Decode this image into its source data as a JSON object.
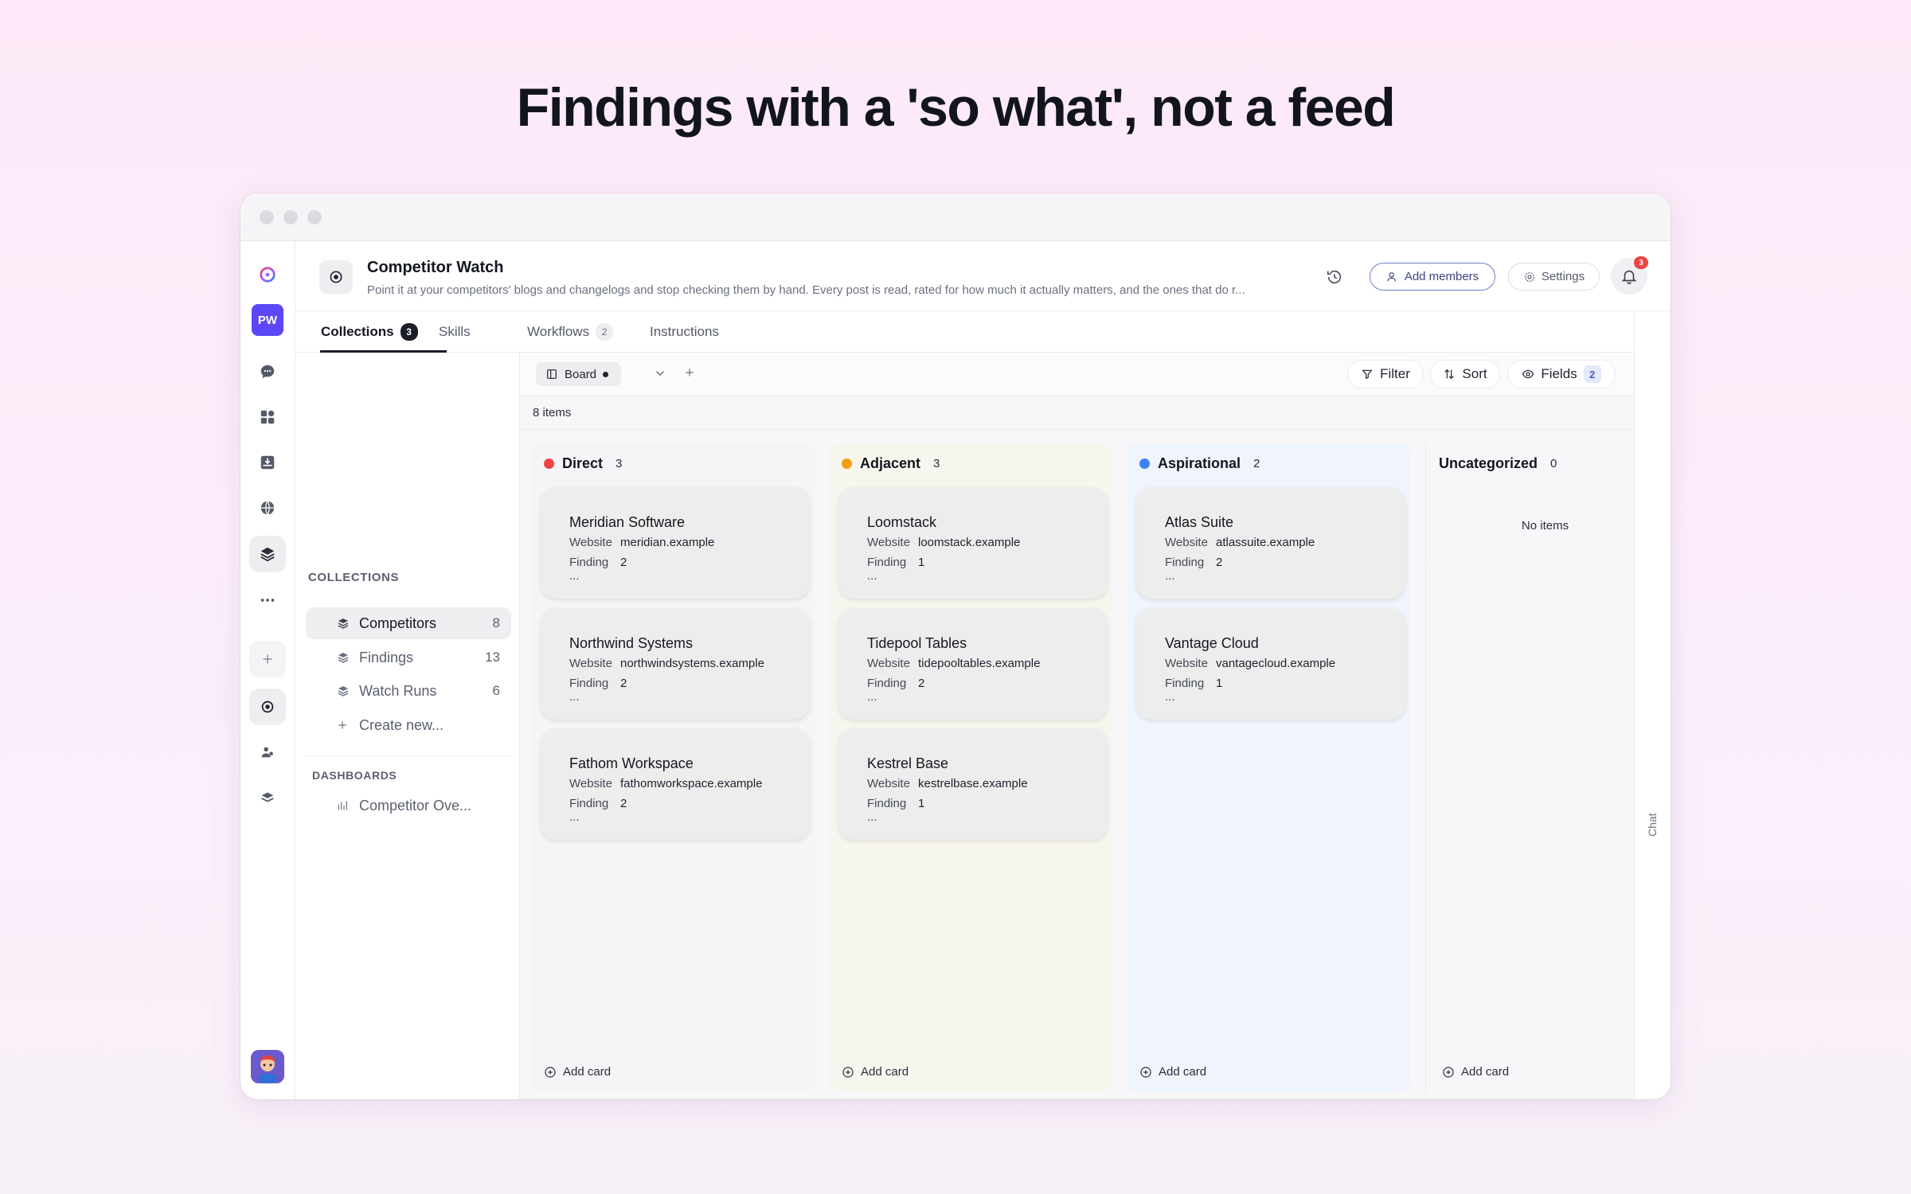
{
  "headline": "Findings with a 'so what', not a feed",
  "rail": {
    "workspace_initials": "PW",
    "icons": [
      "app-logo-icon",
      "chat-icon",
      "apps-grid-icon",
      "inbox-icon",
      "globe-icon",
      "layers-icon",
      "more-icon",
      "plus-icon",
      "project-icon",
      "people-icon",
      "stack-icon",
      "user-avatar"
    ]
  },
  "header": {
    "title": "Competitor Watch",
    "description": "Point it at your competitors' blogs and changelogs and stop checking them by hand. Every post is read, rated for how much it actually matters, and the ones that do r...",
    "add_members_label": "Add members",
    "settings_label": "Settings",
    "notification_count": "3"
  },
  "tabs": [
    {
      "label": "Collections",
      "count": "3"
    },
    {
      "label": "Skills",
      "count": ""
    },
    {
      "label": "Workflows",
      "count": "2"
    },
    {
      "label": "Instructions",
      "count": ""
    }
  ],
  "sidebar": {
    "collections_label": "COLLECTIONS",
    "items": [
      {
        "label": "Competitors",
        "count": "8"
      },
      {
        "label": "Findings",
        "count": "13"
      },
      {
        "label": "Watch Runs",
        "count": "6"
      }
    ],
    "create_label": "Create new...",
    "dashboards_label": "DASHBOARDS",
    "dashboards": [
      {
        "label": "Competitor Ove..."
      }
    ]
  },
  "toolbar": {
    "view_label": "Board",
    "filter_label": "Filter",
    "sort_label": "Sort",
    "fields_label": "Fields",
    "fields_count": "2",
    "items_count": "8 items"
  },
  "colors": {
    "direct": "#ef4444",
    "adjacent": "#f59e0b",
    "aspirational": "#3b82f6",
    "accent": "#5b47f5"
  },
  "columns": [
    {
      "name": "Direct",
      "count": "3",
      "cards": [
        {
          "title": "Meridian Software",
          "website_key": "Website",
          "website": "meridian.example",
          "finding_key": "Finding ...",
          "finding": "2"
        },
        {
          "title": "Northwind Systems",
          "website_key": "Website",
          "website": "northwindsystems.example",
          "finding_key": "Finding ...",
          "finding": "2"
        },
        {
          "title": "Fathom Workspace",
          "website_key": "Website",
          "website": "fathomworkspace.example",
          "finding_key": "Finding ...",
          "finding": "2"
        }
      ],
      "add_label": "Add card"
    },
    {
      "name": "Adjacent",
      "count": "3",
      "cards": [
        {
          "title": "Loomstack",
          "website_key": "Website",
          "website": "loomstack.example",
          "finding_key": "Finding ...",
          "finding": "1"
        },
        {
          "title": "Tidepool Tables",
          "website_key": "Website",
          "website": "tidepooltables.example",
          "finding_key": "Finding ...",
          "finding": "2"
        },
        {
          "title": "Kestrel Base",
          "website_key": "Website",
          "website": "kestrelbase.example",
          "finding_key": "Finding ...",
          "finding": "1"
        }
      ],
      "add_label": "Add card"
    },
    {
      "name": "Aspirational",
      "count": "2",
      "cards": [
        {
          "title": "Atlas Suite",
          "website_key": "Website",
          "website": "atlassuite.example",
          "finding_key": "Finding ...",
          "finding": "2"
        },
        {
          "title": "Vantage Cloud",
          "website_key": "Website",
          "website": "vantagecloud.example",
          "finding_key": "Finding ...",
          "finding": "1"
        }
      ],
      "add_label": "Add card"
    },
    {
      "name": "Uncategorized",
      "count": "0",
      "empty_label": "No items",
      "add_label": "Add card"
    }
  ],
  "chat_label": "Chat"
}
